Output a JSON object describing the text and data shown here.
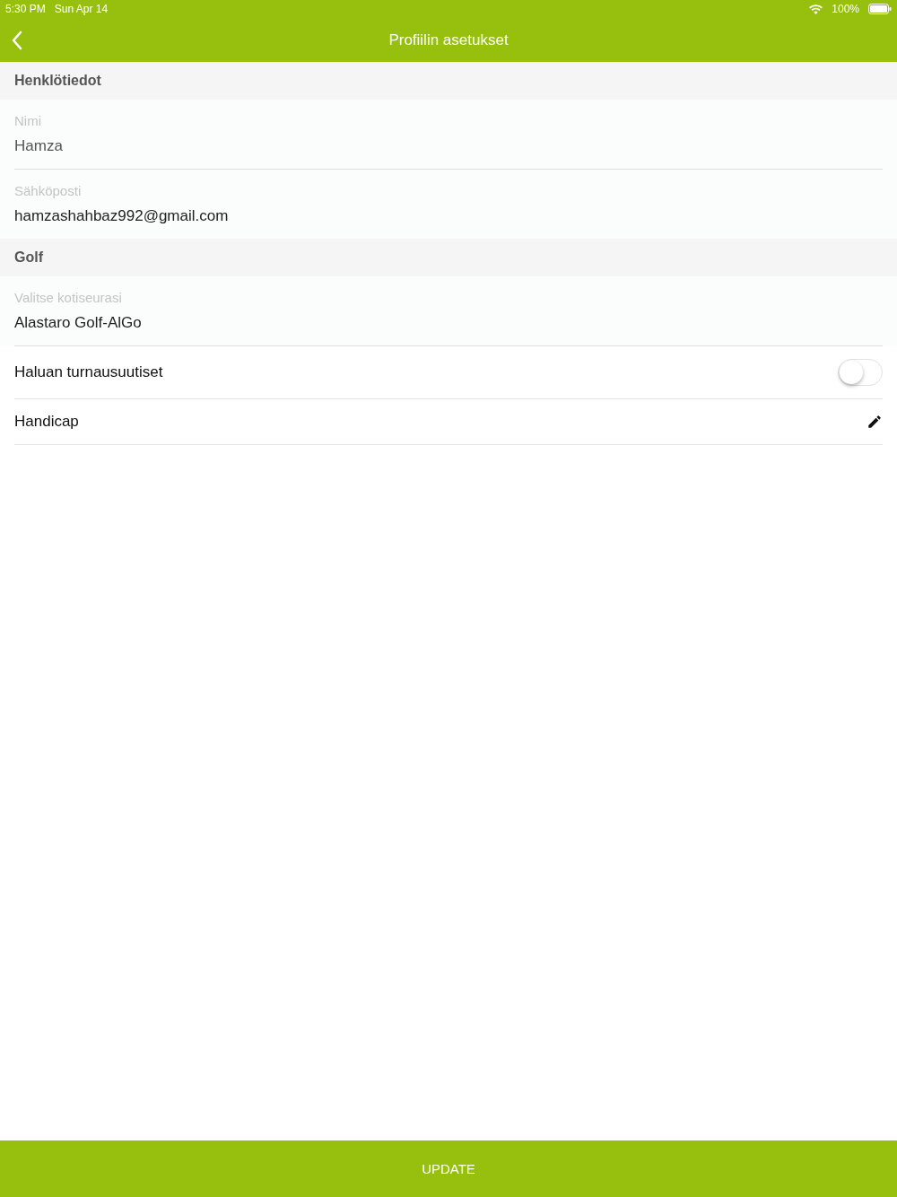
{
  "status_bar": {
    "time": "5:30 PM",
    "date": "Sun Apr 14",
    "battery": "100%"
  },
  "nav": {
    "title": "Profiilin asetukset"
  },
  "sections": [
    {
      "title": "Henklötiedot",
      "items": [
        {
          "kind": "field",
          "label": "Nimi",
          "value": "Hamza",
          "disabled": true
        },
        {
          "kind": "field",
          "label": "Sähköposti",
          "value": "hamzashahbaz992@gmail.com",
          "disabled": false
        }
      ]
    },
    {
      "title": "Golf",
      "items": [
        {
          "kind": "field",
          "label": "Valitse kotiseurasi",
          "value": "Alastaro Golf-AlGo",
          "disabled": false
        },
        {
          "kind": "toggle",
          "label": "Haluan turnausuutiset",
          "on": false
        },
        {
          "kind": "edit",
          "label": "Handicap"
        }
      ]
    }
  ],
  "footer_button": "UPDATE"
}
